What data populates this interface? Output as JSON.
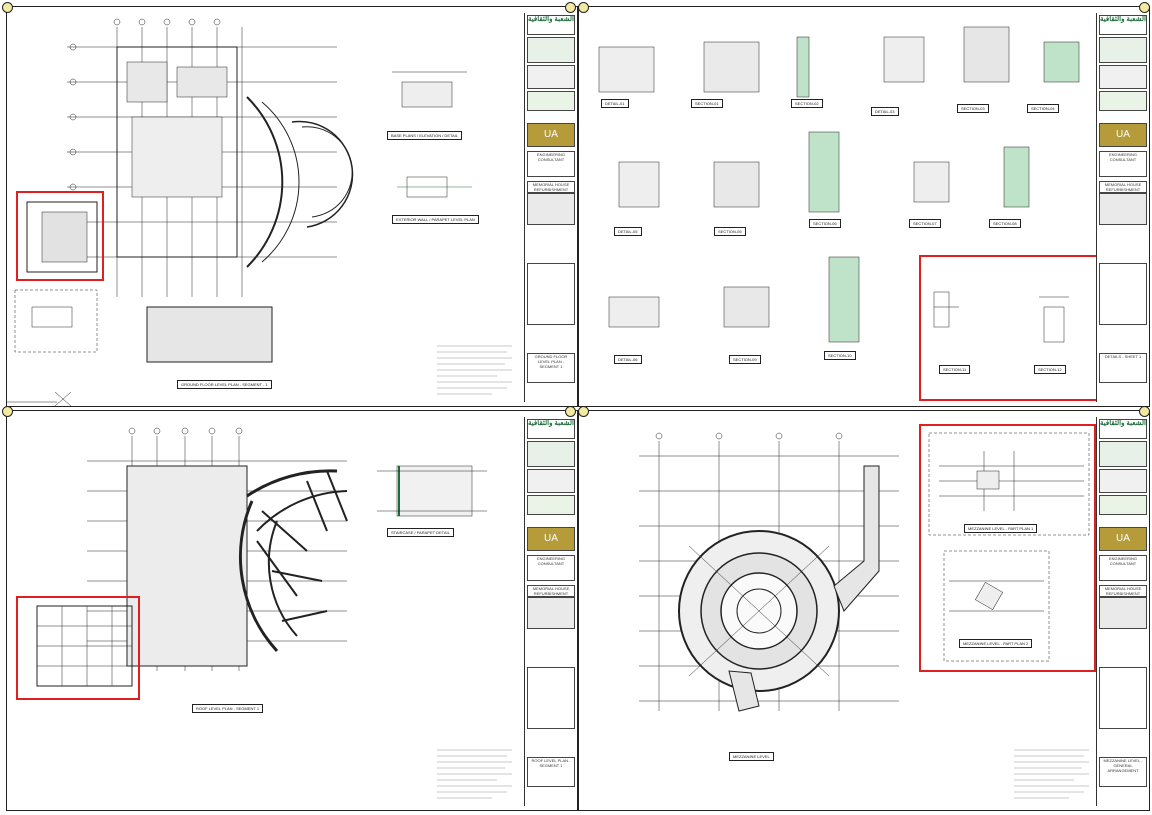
{
  "sheets": [
    {
      "id": "tl",
      "plan_title": "GROUND FLOOR LEVEL PLAN - SEGMENT - 1",
      "detail_labels": [
        "BASE PLANS / ELEVATION / DETAIL",
        "EXTERIOR WALL / PARAPET LEVEL PLAN"
      ],
      "tb_title": "GROUND FLOOR LEVEL PLAN - SEGMENT 1"
    },
    {
      "id": "tr",
      "detail_labels": [
        "DETAIL-01",
        "SECTION-01",
        "SECTION-02",
        "DETAIL-03",
        "SECTION-03",
        "SECTION-04",
        "DETAIL-05",
        "SECTION-05",
        "SECTION-06",
        "SECTION-07",
        "SECTION-08",
        "DETAIL-06",
        "SECTION-09",
        "SECTION-10",
        "SECTION-11",
        "SECTION-12"
      ],
      "tb_title": "DETAILS - SHEET 1"
    },
    {
      "id": "bl",
      "plan_title": "ROOF LEVEL PLAN - SEGMENT 1",
      "detail_labels": [
        "STAIRCASE / PARAPET DETAIL"
      ],
      "tb_title": "ROOF LEVEL PLAN - SEGMENT 1"
    },
    {
      "id": "br",
      "plan_title": "MEZZANINE LEVEL",
      "detail_labels": [
        "MEZZANINE LEVEL - PART PLAN 1",
        "MEZZANINE LEVEL - PART PLAN 2"
      ],
      "tb_title": "MEZZANINE LEVEL - GENERAL ARRANGEMENT"
    }
  ],
  "title_block": {
    "arabic_name": "الشعبة والثقافية",
    "gold_mark": "UA",
    "consultant": "ENGINEERING CONSULTANT",
    "project": "MEMORIAL HOUSE REFURBISHMENT"
  },
  "colors": {
    "highlight": "#e02020",
    "accent_green": "#1e6b3a",
    "gold": "#b59b3a",
    "line": "#222222",
    "steel_fill": "#bfe3c8"
  }
}
